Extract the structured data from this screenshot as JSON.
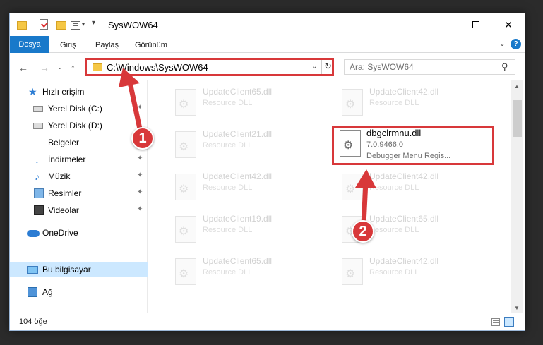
{
  "window": {
    "title": "SysWOW64"
  },
  "ribbon": {
    "tabs": [
      "Dosya",
      "Giriş",
      "Paylaş",
      "Görünüm"
    ],
    "help": "?"
  },
  "nav": {
    "address": "C:\\Windows\\SysWOW64",
    "search_placeholder": "Ara: SysWOW64"
  },
  "sidebar": {
    "items": [
      {
        "label": "Hızlı erişim",
        "icon": "star-icon"
      },
      {
        "label": "Yerel Disk (C:)",
        "icon": "drive-icon"
      },
      {
        "label": "Yerel Disk (D:)",
        "icon": "drive-icon"
      },
      {
        "label": "Belgeler",
        "icon": "documents-icon"
      },
      {
        "label": "İndirmeler",
        "icon": "download-icon"
      },
      {
        "label": "Müzik",
        "icon": "music-icon"
      },
      {
        "label": "Resimler",
        "icon": "pictures-icon"
      },
      {
        "label": "Videolar",
        "icon": "videos-icon"
      },
      {
        "label": "OneDrive",
        "icon": "cloud-icon"
      },
      {
        "label": "Bu bilgisayar",
        "icon": "computer-icon"
      },
      {
        "label": "Ağ",
        "icon": "network-icon"
      }
    ]
  },
  "files": {
    "left": [
      {
        "name": "UpdateClient65.dll",
        "type": "Resource DLL"
      },
      {
        "name": "UpdateClient21.dll",
        "type": "Resource DLL"
      },
      {
        "name": "UpdateClient42.dll",
        "type": "Resource DLL"
      },
      {
        "name": "UpdateClient19.dll",
        "type": "Resource DLL"
      },
      {
        "name": "UpdateClient65.dll",
        "type": "Resource DLL"
      }
    ],
    "right": [
      {
        "name": "UpdateClient42.dll",
        "type": "Resource DLL"
      },
      {
        "name": "UpdateClient42.dll",
        "type": "Resource DLL"
      },
      {
        "name": "UpdateClient65.dll",
        "type": "Resource DLL"
      },
      {
        "name": "UpdateClient42.dll",
        "type": "Resource DLL"
      }
    ],
    "highlighted": {
      "name": "dbgclrmnu.dll",
      "version": "7.0.9466.0",
      "description": "Debugger Menu Regis..."
    }
  },
  "status": {
    "count": "104 öğe"
  },
  "annotations": {
    "step1": "1",
    "step2": "2",
    "color": "#d8383a"
  }
}
